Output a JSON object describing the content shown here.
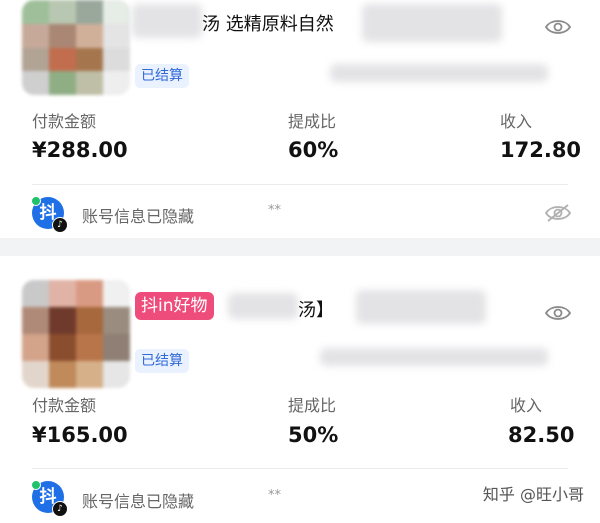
{
  "orders": [
    {
      "title_visible": "汤 选精原料自然",
      "status": "已结算",
      "payment_label": "付款金额",
      "payment_value": "¥288.00",
      "rate_label": "提成比",
      "rate_value": "60%",
      "income_label": "收入",
      "income_value": "172.80",
      "account_hidden_text": "账号信息已隐藏",
      "account_mask": "**"
    },
    {
      "platform_tag": "抖in好物",
      "title_visible": "汤】",
      "status": "已结算",
      "payment_label": "付款金额",
      "payment_value": "¥165.00",
      "rate_label": "提成比",
      "rate_value": "50%",
      "income_label": "收入",
      "income_value": "82.50",
      "account_hidden_text": "账号信息已隐藏",
      "account_mask": "**"
    }
  ],
  "logo_glyph": "抖",
  "watermark": "知乎 @旺小哥",
  "colors": {
    "status_text": "#3069d8",
    "status_bg": "#eaf1ff",
    "platform_tag_bg": "#ee4d7b",
    "logo_bg": "#1f6fe6"
  },
  "icons": [
    "eye-icon",
    "eye-off-icon",
    "douyin-logo-icon"
  ]
}
